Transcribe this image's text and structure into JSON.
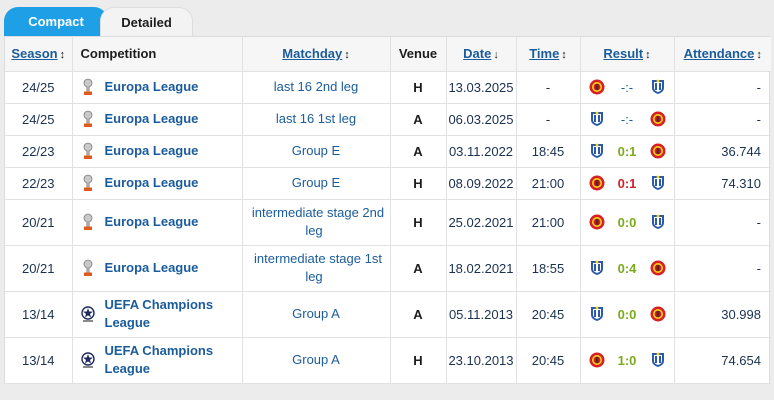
{
  "tabs": {
    "compact": "Compact",
    "detailed": "Detailed"
  },
  "headers": {
    "season": "Season",
    "season_sort": "↕",
    "competition": "Competition",
    "matchday": "Matchday",
    "matchday_sort": "↕",
    "venue": "Venue",
    "date": "Date",
    "date_sort": "↓",
    "time": "Time",
    "time_sort": "↕",
    "result": "Result",
    "result_sort": "↕",
    "attendance": "Attendance",
    "attendance_sort": "↕"
  },
  "rows": [
    {
      "season": "24/25",
      "competition": "Europa League",
      "comp_icon": "europa-league-trophy",
      "matchday": "last 16 2nd leg",
      "venue": "H",
      "date": "13.03.2025",
      "time": "-",
      "home": "manchester-united-crest",
      "score": "-:-",
      "score_type": "none",
      "away": "real-sociedad-crest",
      "attendance": "-"
    },
    {
      "season": "24/25",
      "competition": "Europa League",
      "comp_icon": "europa-league-trophy",
      "matchday": "last 16 1st leg",
      "venue": "A",
      "date": "06.03.2025",
      "time": "-",
      "home": "real-sociedad-crest",
      "score": "-:-",
      "score_type": "none",
      "away": "manchester-united-crest",
      "attendance": "-"
    },
    {
      "season": "22/23",
      "competition": "Europa League",
      "comp_icon": "europa-league-trophy",
      "matchday": "Group E",
      "venue": "A",
      "date": "03.11.2022",
      "time": "18:45",
      "home": "real-sociedad-crest",
      "score": "0:1",
      "score_type": "draw",
      "away": "manchester-united-crest",
      "attendance": "36.744"
    },
    {
      "season": "22/23",
      "competition": "Europa League",
      "comp_icon": "europa-league-trophy",
      "matchday": "Group E",
      "venue": "H",
      "date": "08.09.2022",
      "time": "21:00",
      "home": "manchester-united-crest",
      "score": "0:1",
      "score_type": "loss",
      "away": "real-sociedad-crest",
      "attendance": "74.310"
    },
    {
      "season": "20/21",
      "competition": "Europa League",
      "comp_icon": "europa-league-trophy",
      "matchday": "intermediate stage 2nd leg",
      "venue": "H",
      "date": "25.02.2021",
      "time": "21:00",
      "home": "manchester-united-crest",
      "score": "0:0",
      "score_type": "draw",
      "away": "real-sociedad-crest",
      "attendance": "-"
    },
    {
      "season": "20/21",
      "competition": "Europa League",
      "comp_icon": "europa-league-trophy",
      "matchday": "intermediate stage 1st leg",
      "venue": "A",
      "date": "18.02.2021",
      "time": "18:55",
      "home": "real-sociedad-crest",
      "score": "0:4",
      "score_type": "draw",
      "away": "manchester-united-crest",
      "attendance": "-"
    },
    {
      "season": "13/14",
      "competition": "UEFA Champions League",
      "comp_icon": "champions-league-trophy",
      "matchday": "Group A",
      "venue": "A",
      "date": "05.11.2013",
      "time": "20:45",
      "home": "real-sociedad-crest",
      "score": "0:0",
      "score_type": "draw",
      "away": "manchester-united-crest",
      "attendance": "30.998"
    },
    {
      "season": "13/14",
      "competition": "UEFA Champions League",
      "comp_icon": "champions-league-trophy",
      "matchday": "Group A",
      "venue": "H",
      "date": "23.10.2013",
      "time": "20:45",
      "home": "manchester-united-crest",
      "score": "1:0",
      "score_type": "draw",
      "away": "real-sociedad-crest",
      "attendance": "74.654"
    }
  ],
  "colors": {
    "accent": "#1fa0e6",
    "link": "#1a5c9c",
    "draw": "#7aab1c",
    "loss": "#d2232a",
    "mu_red": "#d61f26",
    "rs_blue": "#2a5aa8"
  }
}
